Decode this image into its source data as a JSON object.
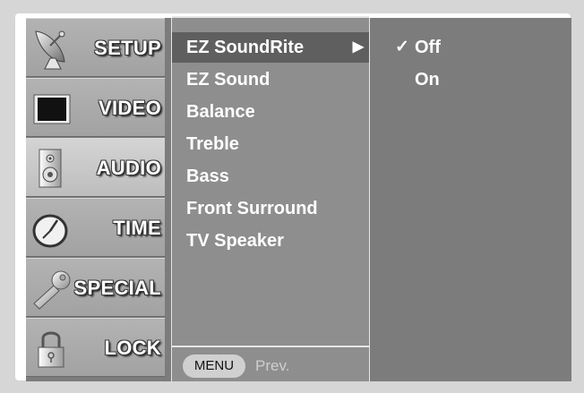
{
  "categories": [
    {
      "label": "SETUP",
      "icon": "satellite-dish-icon"
    },
    {
      "label": "VIDEO",
      "icon": "tv-screen-icon"
    },
    {
      "label": "AUDIO",
      "icon": "speaker-icon",
      "active": true
    },
    {
      "label": "TIME",
      "icon": "clock-icon"
    },
    {
      "label": "SPECIAL",
      "icon": "key-icon"
    },
    {
      "label": "LOCK",
      "icon": "padlock-icon"
    }
  ],
  "submenu": {
    "items": [
      {
        "label": "EZ SoundRite",
        "selected": true,
        "arrow": "▶"
      },
      {
        "label": "EZ Sound"
      },
      {
        "label": "Balance"
      },
      {
        "label": "Treble"
      },
      {
        "label": "Bass"
      },
      {
        "label": "Front Surround"
      },
      {
        "label": "TV Speaker"
      }
    ],
    "menu_button": "MENU",
    "prev_label": "Prev."
  },
  "options": [
    {
      "label": "Off",
      "check": "✓"
    },
    {
      "label": "On",
      "check": ""
    }
  ],
  "colors": {
    "panel_dark": "#7c7c7c",
    "panel_mid": "#8e8e8e",
    "highlight": "#5f5f5f",
    "category_bg": "#a8a8a8",
    "text": "#ffffff"
  }
}
